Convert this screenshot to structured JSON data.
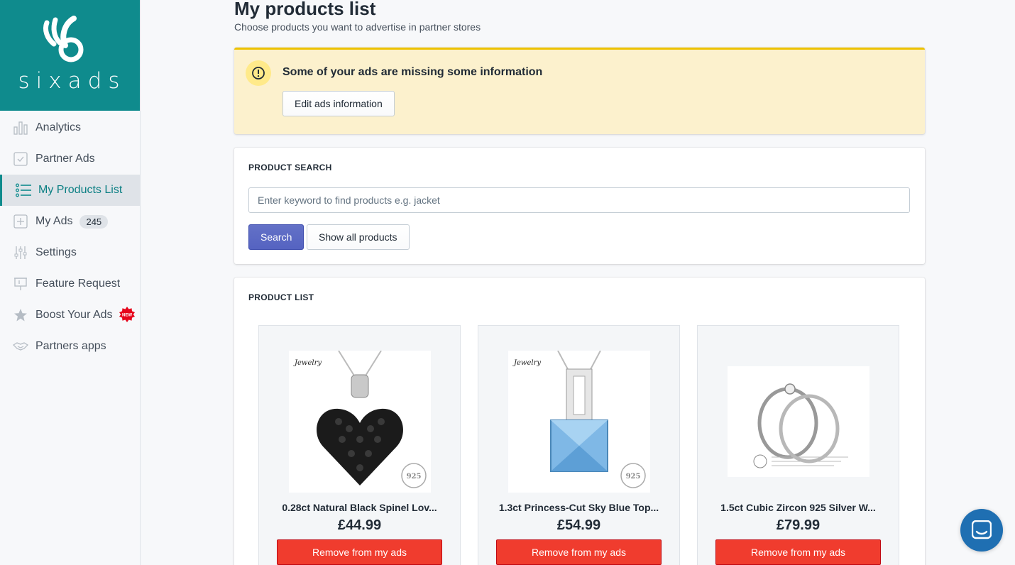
{
  "brand": {
    "name": "sixads",
    "color": "#0f8b8d"
  },
  "sidebar": {
    "items": [
      {
        "label": "Analytics",
        "icon": "bar-chart-icon",
        "active": false
      },
      {
        "label": "Partner Ads",
        "icon": "checkbox-icon",
        "active": false
      },
      {
        "label": "My Products List",
        "icon": "list-icon",
        "active": true
      },
      {
        "label": "My Ads",
        "icon": "plus-square-icon",
        "active": false,
        "badge": "245"
      },
      {
        "label": "Settings",
        "icon": "sliders-icon",
        "active": false
      },
      {
        "label": "Feature Request",
        "icon": "presentation-icon",
        "active": false
      },
      {
        "label": "Boost Your Ads",
        "icon": "star-icon",
        "active": false,
        "new_badge": "NEW"
      },
      {
        "label": "Partners apps",
        "icon": "handshake-icon",
        "active": false
      }
    ]
  },
  "header": {
    "title": "My products list",
    "subtitle": "Choose products you want to advertise in partner stores"
  },
  "banner": {
    "title": "Some of your ads are missing some information",
    "button_label": "Edit ads information",
    "color": "#fcf1cd",
    "accent": "#eec200"
  },
  "search": {
    "section_title": "PRODUCT SEARCH",
    "placeholder": "Enter keyword to find products e.g. jacket",
    "value": "",
    "search_button": "Search",
    "show_all_button": "Show all products",
    "primary_color": "#5c6ac4"
  },
  "product_list": {
    "section_title": "PRODUCT LIST",
    "products": [
      {
        "name": "0.28ct Natural Black Spinel Lov...",
        "price": "£44.99",
        "button": "Remove from my ads",
        "image": "black-heart-pendant"
      },
      {
        "name": "1.3ct Princess-Cut Sky Blue Top...",
        "price": "£54.99",
        "button": "Remove from my ads",
        "image": "blue-topaz-pendant"
      },
      {
        "name": "1.5ct Cubic Zircon 925 Silver W...",
        "price": "£79.99",
        "button": "Remove from my ads",
        "image": "silver-ring-set"
      }
    ],
    "remove_color": "#f03c2e"
  },
  "chat": {
    "icon": "chat-icon",
    "color": "#1f6fb2"
  }
}
